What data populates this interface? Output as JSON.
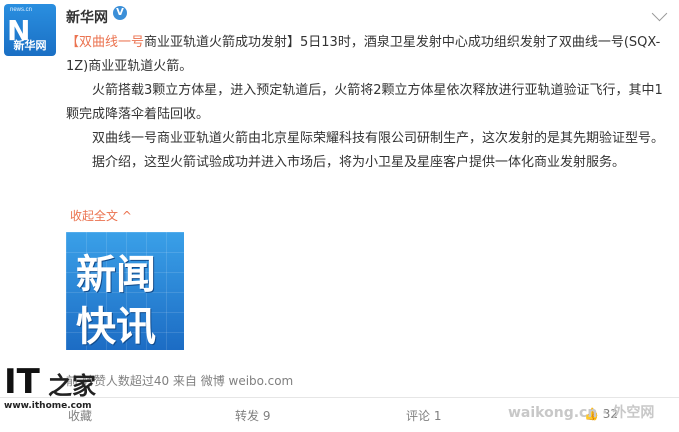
{
  "account": {
    "avatar_small_text": "news.cn",
    "avatar_cn": "新华网",
    "name": "新华网",
    "verified_badge": "V"
  },
  "post": {
    "p1_link": "【双曲线一号",
    "p1_rest": "商业亚轨道火箭成功发射】5日13时，酒泉卫星发射中心成功组织发射了双曲线一号(SQX-1Z)商业亚轨道火箭。",
    "p2": "火箭搭载3颗立方体星，进入预定轨道后，火箭将2颗立方体星依次释放进行亚轨道验证飞行，其中1颗完成降落伞着陆回收。",
    "p3": "双曲线一号商业亚轨道火箭由北京星际荣耀科技有限公司研制生产，这次发射的是其先期验证型号。",
    "p4": "据介绍，这型火箭试验成功并进入市场后，将为小卫星及星座客户提供一体化商业发射服务。",
    "collapse": "收起全文",
    "collapse_icon": "^"
  },
  "thumbnail": {
    "line1": "新闻",
    "line2": "快讯"
  },
  "meta": "前 转赞人数超过40 来自 微博 weibo.com",
  "footer": {
    "favorite": "收藏",
    "repost": "转发 9",
    "comment": "评论 1",
    "like": "32"
  },
  "watermarks": {
    "ithome_it": "IT",
    "ithome_zhi": "之家",
    "ithome_url": "www.ithome.com",
    "waikong": "waikong.cn · 外空网"
  }
}
